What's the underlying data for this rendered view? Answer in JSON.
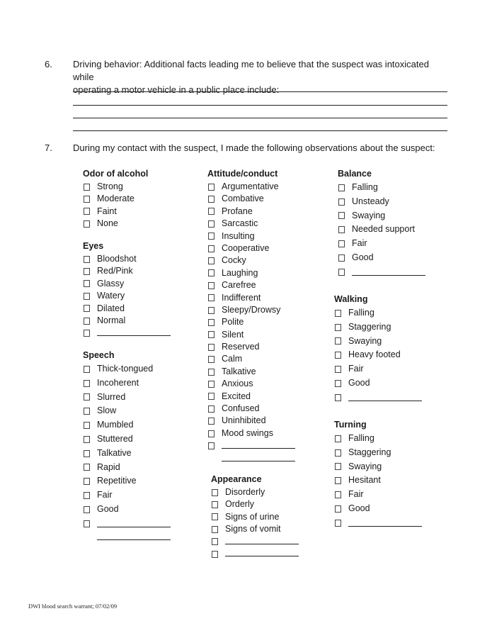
{
  "question6": {
    "number": "6.",
    "line1": "Driving behavior:  Additional facts leading me to believe that the suspect was intoxicated while",
    "line2": "operating a motor vehicle in a public place include: ",
    "blank_lines": 4
  },
  "question7": {
    "number": "7.",
    "text": "During my contact with the suspect, I made the following observations about the suspect:"
  },
  "groups": {
    "odor": {
      "title": "Odor of alcohol",
      "options": [
        "Strong",
        "Moderate",
        "Faint",
        "None"
      ]
    },
    "eyes": {
      "title": "Eyes",
      "options": [
        "Bloodshot",
        "Red/Pink",
        "Glassy",
        "Watery",
        "Dilated",
        "Normal",
        "_______________"
      ]
    },
    "speech": {
      "title": "Speech",
      "options": [
        "Thick-tongued",
        "Incoherent",
        "Slurred",
        "Slow",
        "Mumbled",
        "Stuttered",
        "Talkative",
        "Rapid",
        "Repetitive",
        "Fair",
        "Good",
        "_______________"
      ]
    },
    "attitude": {
      "title": "Attitude/conduct",
      "options": [
        "Argumentative",
        "Combative",
        "Profane",
        "Sarcastic",
        "Insulting",
        "Cooperative",
        "Cocky",
        "Laughing",
        "Carefree",
        "Indifferent",
        "Sleepy/Drowsy",
        "Polite",
        "Silent",
        "Reserved",
        "Calm",
        "Talkative",
        "Anxious",
        "Excited",
        "Confused",
        "Uninhibited",
        "Mood swings",
        "_______________"
      ]
    },
    "appearance": {
      "title": "Appearance",
      "options": [
        "Disorderly",
        "Orderly",
        "Signs of urine",
        "Signs of vomit",
        "_______________",
        "_______________"
      ]
    },
    "balance": {
      "title": "Balance",
      "options": [
        "Falling",
        "Unsteady",
        "Swaying",
        "Needed support",
        "Fair",
        "Good",
        "_______________"
      ]
    },
    "walking": {
      "title": "Walking",
      "options": [
        "Falling",
        "Staggering",
        "Swaying",
        "Heavy footed",
        "Fair",
        "Good",
        "_______________"
      ]
    },
    "turning": {
      "title": "Turning",
      "options": [
        "Falling",
        "Staggering",
        "Swaying",
        "Hesitant",
        "Fair",
        "Good",
        "_______________"
      ]
    }
  },
  "footer": "DWI blood search warrant; 07/02/09"
}
